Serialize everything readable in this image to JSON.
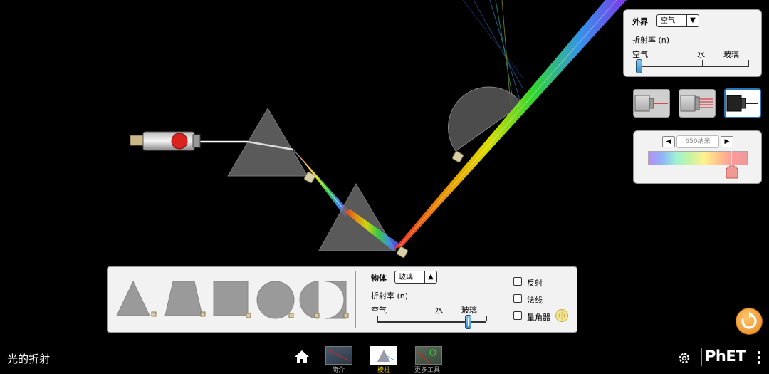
{
  "app": {
    "title": "光的折射"
  },
  "nav_tabs": [
    {
      "label": "简介",
      "selected": false
    },
    {
      "label": "棱柱",
      "selected": true
    },
    {
      "label": "更多工具",
      "selected": false
    }
  ],
  "environment_panel": {
    "title": "外界",
    "medium_selected": "空气",
    "refraction_label": "折射率 (n)",
    "ticks": [
      "空气",
      "水",
      "玻璃"
    ],
    "slider_value": "空气"
  },
  "laser_modes": [
    "single-ray-icon",
    "parallel-rays-icon",
    "white-light-icon"
  ],
  "wavelength": {
    "value": "650纳米",
    "prev_label": "◀",
    "next_label": "▶"
  },
  "object_panel": {
    "title": "物体",
    "medium_selected": "玻璃",
    "refraction_label": "折射率 (n)",
    "ticks": [
      "空气",
      "水",
      "玻璃"
    ],
    "slider_value": "玻璃",
    "shapes": [
      "triangle",
      "trapezoid",
      "square",
      "circle",
      "semicircle"
    ]
  },
  "checkboxes": [
    {
      "label": "反射",
      "checked": false
    },
    {
      "label": "法线",
      "checked": false
    },
    {
      "label": "量角器",
      "checked": false
    }
  ],
  "brand": {
    "logo": "PhET"
  },
  "colors": {
    "accent": "#2c73b9",
    "reset": "#f0a23a",
    "bg": "#000000"
  }
}
